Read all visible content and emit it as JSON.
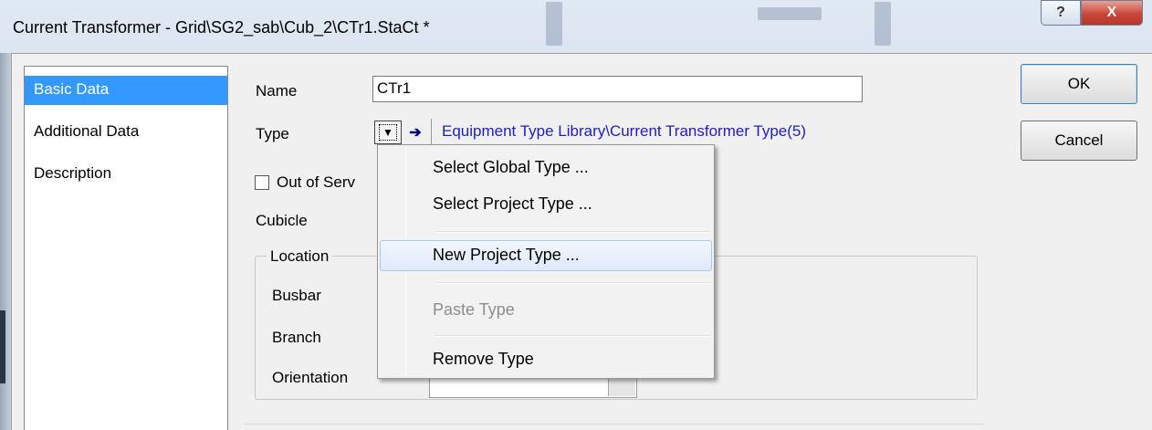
{
  "window": {
    "title": "Current Transformer - Grid\\SG2_sab\\Cub_2\\CTr1.StaCt *",
    "help_glyph": "?",
    "close_glyph": "X"
  },
  "nav": {
    "items": [
      {
        "label": "Basic Data",
        "selected": true
      },
      {
        "label": "Additional Data",
        "selected": false
      },
      {
        "label": "Description",
        "selected": false
      }
    ]
  },
  "form": {
    "name_label": "Name",
    "name_value": "CTr1",
    "type_label": "Type",
    "type_link": "Equipment Type Library\\Current Transformer Type(5)",
    "out_of_service_label": "Out of Serv",
    "out_of_service_checked": false,
    "cubicle_label": "Cubicle",
    "location_group_label": "Location",
    "busbar_label": "Busbar",
    "branch_label": "Branch",
    "orientation_label": "Orientation"
  },
  "buttons": {
    "ok": "OK",
    "cancel": "Cancel"
  },
  "context_menu": {
    "select_global": "Select Global Type ...",
    "select_project": "Select Project Type ...",
    "new_project": "New Project Type ...",
    "paste": "Paste Type",
    "remove": "Remove Type"
  },
  "colors": {
    "selection": "#3399ff",
    "link": "#2020c0",
    "close_button": "#c9473a"
  },
  "icons": {
    "type_dropdown": "chevron-down-icon",
    "type_jump": "arrow-right-icon"
  }
}
